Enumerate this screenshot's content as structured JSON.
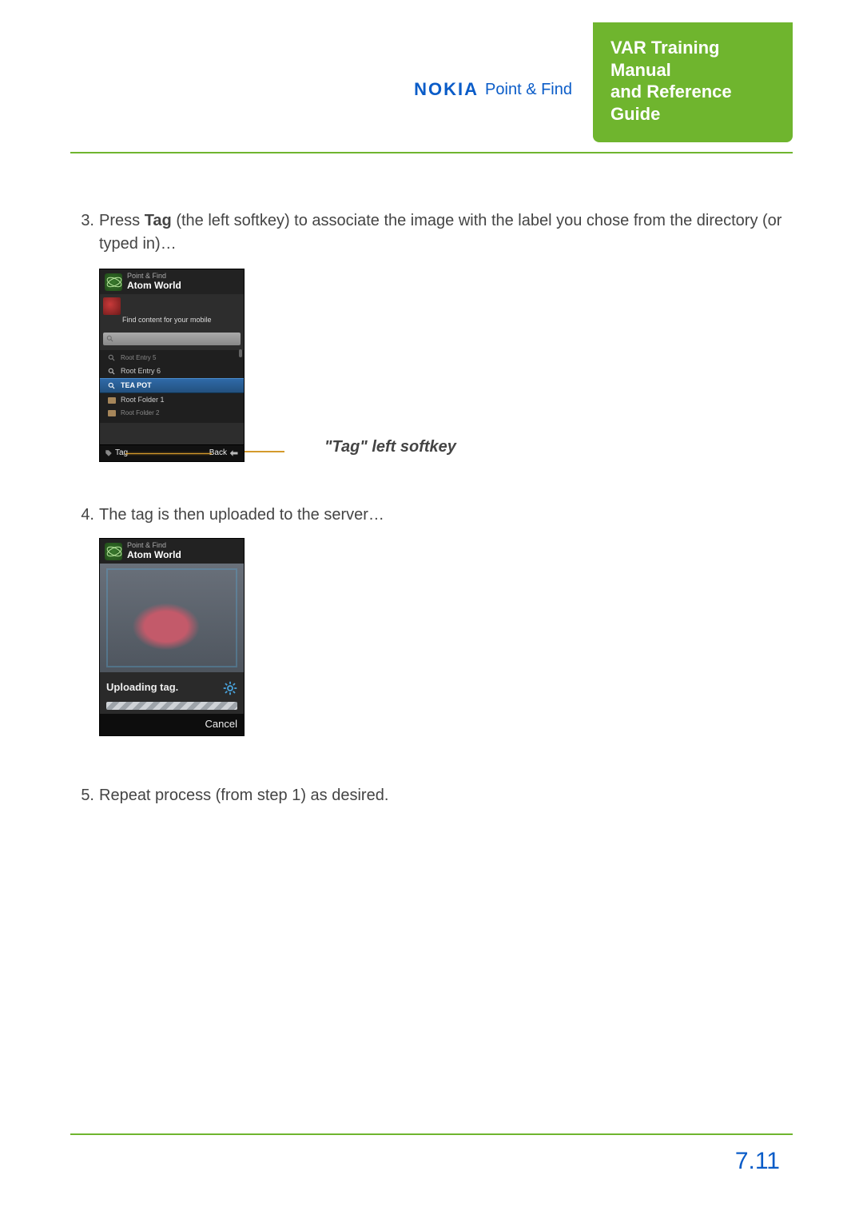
{
  "header": {
    "brand_name": "NOKIA",
    "brand_sub": "Point & Find",
    "title_line1": "VAR Training Manual",
    "title_line2": "and Reference Guide"
  },
  "steps": {
    "s3": {
      "num": "3.",
      "pre": "Press ",
      "bold": "Tag",
      "post": " (the left softkey) to associate the image with the label you chose from the directory (or typed in)…"
    },
    "s4": {
      "num": "4.",
      "text": "The tag is then uploaded to the server…"
    },
    "s5": {
      "num": "5.",
      "text": "Repeat process (from step 1) as desired."
    }
  },
  "callout": {
    "label": "\"Tag\" left softkey"
  },
  "phone1": {
    "title_small": "Point & Find",
    "title_big": "Atom World",
    "find_text": "Find content for your mobile",
    "items": {
      "i0": "Root Entry 5",
      "i1": "Root Entry 6",
      "i2": "TEA POT",
      "i3": "Root Folder 1",
      "i4": "Root Folder 2"
    },
    "softkey_left": "Tag",
    "softkey_right": "Back"
  },
  "phone2": {
    "title_small": "Point & Find",
    "title_big": "Atom World",
    "status": "Uploading tag.",
    "cancel": "Cancel"
  },
  "page_number": "7.11"
}
